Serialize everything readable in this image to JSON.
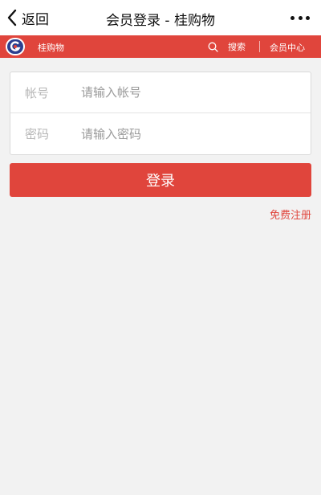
{
  "topbar": {
    "back_label": "返回",
    "title": "会员登录 - 桂购物"
  },
  "header": {
    "brand": "桂购物",
    "search_label": "搜索",
    "member_center_label": "会员中心"
  },
  "form": {
    "account_label": "帐号",
    "account_placeholder": "请输入帐号",
    "account_value": "",
    "password_label": "密码",
    "password_placeholder": "请输入密码",
    "password_value": ""
  },
  "actions": {
    "login_label": "登录",
    "register_label": "免费注册"
  },
  "colors": {
    "accent": "#e0453c",
    "background": "#f2f2f2",
    "logo_blue": "#2b3f8f"
  },
  "icons": {
    "back": "chevron-left-icon",
    "more": "more-dots-icon",
    "logo": "logo-g-icon",
    "search": "search-icon"
  }
}
